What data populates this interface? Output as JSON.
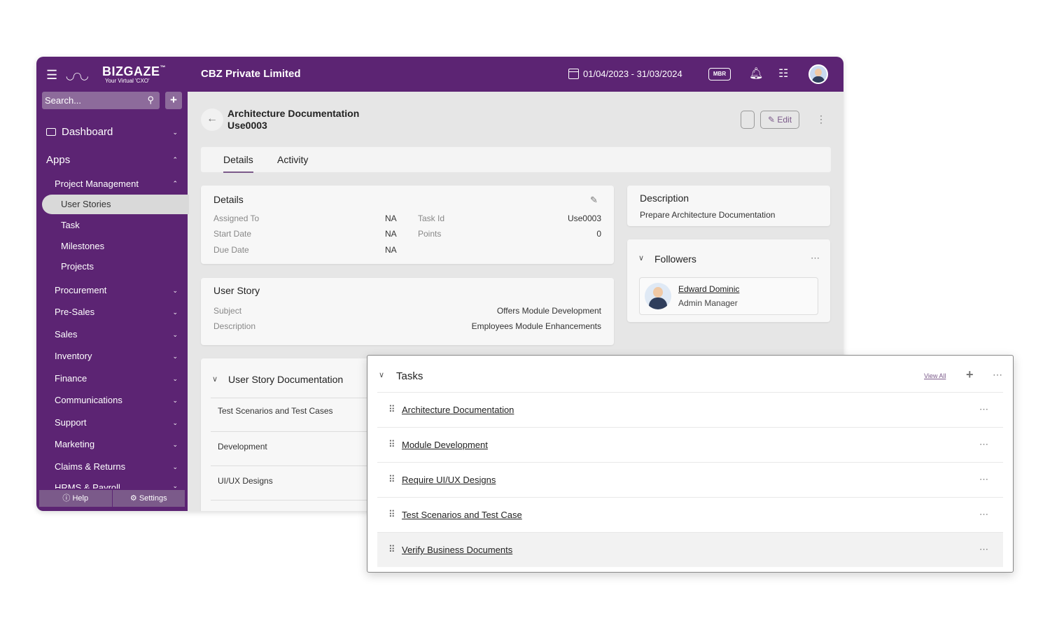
{
  "header": {
    "logo_brand": "BIZGAZE",
    "logo_tm": "™",
    "logo_tagline": "Your Virtual 'CXO'",
    "company": "CBZ Private Limited",
    "date_range": "01/04/2023 - 31/03/2024",
    "mbr_label": "MBR"
  },
  "sidebar": {
    "search_placeholder": "Search...",
    "dashboard": "Dashboard",
    "apps": "Apps",
    "project_management": "Project Management",
    "pm_items": [
      "User Stories",
      "Task",
      "Milestones",
      "Projects"
    ],
    "groups": [
      "Procurement",
      "Pre-Sales",
      "Sales",
      "Inventory",
      "Finance",
      "Communications",
      "Support",
      "Marketing",
      "Claims & Returns",
      "HRMS & Payroll"
    ],
    "help": "Help",
    "settings": "Settings"
  },
  "page": {
    "title": "Architecture Documentation",
    "subtitle": "Use0003",
    "edit_label": "Edit",
    "tabs": [
      "Details",
      "Activity"
    ]
  },
  "details": {
    "heading": "Details",
    "assigned_to_label": "Assigned To",
    "assigned_to": "NA",
    "start_date_label": "Start Date",
    "start_date": "NA",
    "due_date_label": "Due Date",
    "due_date": "NA",
    "task_id_label": "Task Id",
    "task_id": "Use0003",
    "points_label": "Points",
    "points": "0"
  },
  "user_story": {
    "heading": "User Story",
    "subject_label": "Subject",
    "subject": "Offers Module Development",
    "description_label": "Description",
    "description": "Employees Module Enhancements"
  },
  "description": {
    "heading": "Description",
    "text": "Prepare Architecture Documentation"
  },
  "followers": {
    "heading": "Followers",
    "name": "Edward Dominic",
    "role": "Admin Manager"
  },
  "documentation": {
    "heading": "User Story Documentation",
    "rows": [
      "Test Scenarios and Test Cases",
      "Development",
      "UI/UX Designs"
    ]
  },
  "tasks": {
    "heading": "Tasks",
    "view_all": "View All",
    "items": [
      "Architecture Documentation",
      "Module Development",
      "Require UI/UX Designs",
      "Test Scenarios and Test Case",
      "Verify Business Documents"
    ]
  },
  "colors": {
    "brand_purple": "#5c2473",
    "accent": "#7b5a8a"
  }
}
